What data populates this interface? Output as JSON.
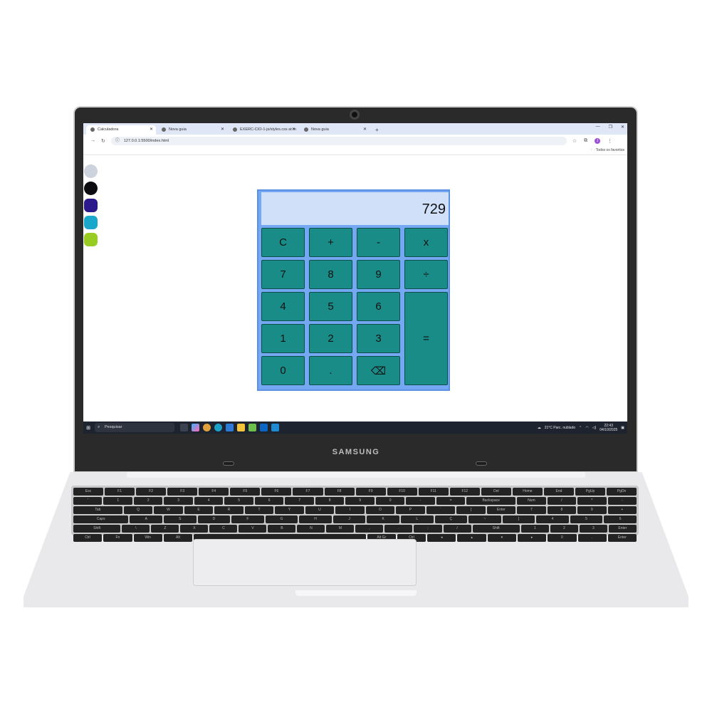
{
  "device": {
    "brand": "SAMSUNG"
  },
  "browser": {
    "tabs": [
      {
        "label": "Calculadora",
        "active": true
      },
      {
        "label": "Nova guia",
        "active": false
      },
      {
        "label": "EXERC-CIO-1-js/styles.css at m",
        "active": false
      },
      {
        "label": "Nova guia",
        "active": false
      }
    ],
    "new_tab": "+",
    "url": "127.0.0.1:5500/index.html",
    "bookmarks_folder": "Todos os favoritos",
    "profile_initial": "J"
  },
  "swatches": [
    "#cdd3dc",
    "#0b0b10",
    "#2c1a8c",
    "#1aa7c9",
    "#99cc22"
  ],
  "calculator": {
    "display": "729",
    "buttons": [
      {
        "label": "C"
      },
      {
        "label": "+"
      },
      {
        "label": "-"
      },
      {
        "label": "x"
      },
      {
        "label": "7"
      },
      {
        "label": "8"
      },
      {
        "label": "9"
      },
      {
        "label": "÷"
      },
      {
        "label": "4"
      },
      {
        "label": "5"
      },
      {
        "label": "6"
      },
      {
        "label": "="
      },
      {
        "label": "1"
      },
      {
        "label": "2"
      },
      {
        "label": "3"
      },
      {
        "label": "0"
      },
      {
        "label": "."
      },
      {
        "label": "⌫"
      }
    ]
  },
  "taskbar": {
    "search_placeholder": "Pesquisar",
    "weather": "21°C  Parc. nublado",
    "time": "22:43",
    "date": "04/10/2025"
  },
  "keyboard": {
    "rows": [
      [
        "Esc",
        "F1",
        "F2",
        "F3",
        "F4",
        "F5",
        "F6",
        "F7",
        "F8",
        "F9",
        "F10",
        "F11",
        "F12",
        "Del",
        "Home",
        "End",
        "PgUp",
        "PgDn"
      ],
      [
        "'",
        "1",
        "2",
        "3",
        "4",
        "5",
        "6",
        "7",
        "8",
        "9",
        "0",
        "-",
        "=",
        "Backspace",
        "Num",
        "/",
        "*",
        "-"
      ],
      [
        "Tab",
        "Q",
        "W",
        "E",
        "R",
        "T",
        "Y",
        "U",
        "I",
        "O",
        "P",
        "´",
        "[",
        "Enter",
        "7",
        "8",
        "9",
        "+"
      ],
      [
        "Caps",
        "A",
        "S",
        "D",
        "F",
        "G",
        "H",
        "J",
        "K",
        "L",
        "Ç",
        "~",
        "]",
        "4",
        "5",
        "6"
      ],
      [
        "Shift",
        "\\",
        "Z",
        "X",
        "C",
        "V",
        "B",
        "N",
        "M",
        ",",
        ".",
        ";",
        "/",
        "Shift",
        "1",
        "2",
        "3",
        "Enter"
      ],
      [
        "Ctrl",
        "Fn",
        "Win",
        "Alt",
        "",
        "Alt Gr",
        "Ctrl",
        "◂",
        "▴",
        "▾",
        "▸",
        "0",
        ".",
        "Enter"
      ]
    ]
  },
  "colors": {
    "button": "#1a8c88",
    "display": "#cfe0f8",
    "frame": "#74a8f3"
  }
}
